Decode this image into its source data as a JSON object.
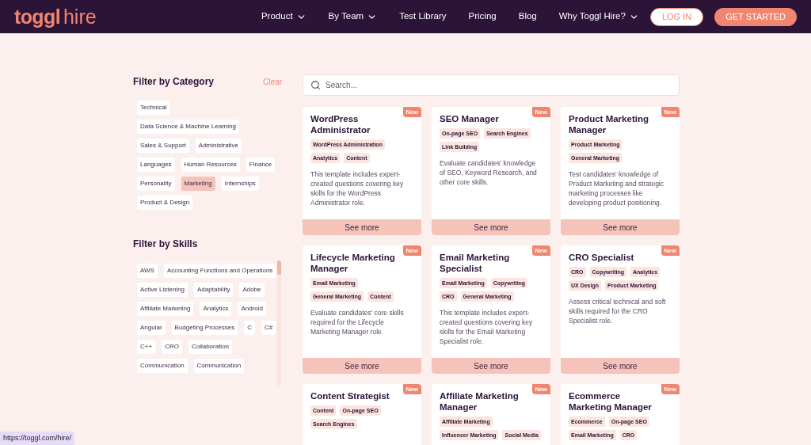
{
  "logo": {
    "brand": "toggl",
    "product": "hire"
  },
  "nav": [
    {
      "label": "Product",
      "has_menu": true
    },
    {
      "label": "By Team",
      "has_menu": true
    },
    {
      "label": "Test Library",
      "has_menu": false
    },
    {
      "label": "Pricing",
      "has_menu": false
    },
    {
      "label": "Blog",
      "has_menu": false
    },
    {
      "label": "Why Toggl Hire?",
      "has_menu": true
    }
  ],
  "nav_buttons": [
    {
      "label": "LOG IN",
      "kind": "outline"
    },
    {
      "label": "GET STARTED",
      "kind": "filled"
    }
  ],
  "category_filter": {
    "title": "Filter by Category",
    "clear": "Clear",
    "chips": [
      {
        "label": "Technical",
        "selected": false
      },
      {
        "label": "Data Science & Machine Learning",
        "selected": false
      },
      {
        "label": "Sales & Support",
        "selected": false
      },
      {
        "label": "Administrative",
        "selected": false
      },
      {
        "label": "Languages",
        "selected": false
      },
      {
        "label": "Human Resources",
        "selected": false
      },
      {
        "label": "Finance",
        "selected": false
      },
      {
        "label": "Personality",
        "selected": false
      },
      {
        "label": "Marketing",
        "selected": true
      },
      {
        "label": "Internships",
        "selected": false
      },
      {
        "label": "Product & Design",
        "selected": false
      }
    ]
  },
  "skills_filter": {
    "title": "Filter by Skills",
    "chips": [
      "AWS",
      "Accounting Functions and Operations",
      "Active Listening",
      "Adaptability",
      "Adobe",
      "Affiliate Marketing",
      "Analytics",
      "Android",
      "Angular",
      "Budgeting Processes",
      "C",
      "C#",
      "C++",
      "CRO",
      "Collaboration",
      "Communication",
      "Communication"
    ]
  },
  "search": {
    "placeholder": "Search..."
  },
  "cards": [
    {
      "title": "WordPress Administrator",
      "badge": "New",
      "tags": [
        "WordPress Administration",
        "Analytics",
        "Content"
      ],
      "description": "This template includes expert-created questions covering key skills for the WordPress Administrator role.",
      "button": "See more"
    },
    {
      "title": "SEO Manager",
      "badge": "New",
      "tags": [
        "On-page SEO",
        "Search Engines",
        "Link Building"
      ],
      "description": "Evaluate candidates' knowledge of SEO, Keyword Research, and other core skills.",
      "button": "See more"
    },
    {
      "title": "Product Marketing Manager",
      "badge": "New",
      "tags": [
        "Product Marketing",
        "General Marketing"
      ],
      "description": "Test candidates' knowledge of Product Marketing and strategic marketing processes like developing product positioning.",
      "button": "See more"
    },
    {
      "title": "Lifecycle Marketing Manager",
      "badge": "New",
      "tags": [
        "Email Marketing",
        "General Marketing",
        "Content"
      ],
      "description": "Evaluate candidates' core skills required for the Lifecycle Marketing Manager role.",
      "button": "See more"
    },
    {
      "title": "Email Marketing Specialist",
      "badge": "New",
      "tags": [
        "Email Marketing",
        "Copywriting",
        "CRO",
        "General Marketing"
      ],
      "description": "This template includes expert-created questions covering key skills for the Email Marketing Specialist role.",
      "button": "See more"
    },
    {
      "title": "CRO Specialist",
      "badge": "New",
      "tags": [
        "CRO",
        "Copywriting",
        "Analytics",
        "UX Design",
        "Product Marketing"
      ],
      "description": "Assess critical technical and soft skills required for the CRO Specialist role.",
      "button": "See more"
    },
    {
      "title": "Content Strategist",
      "badge": "New",
      "tags": [
        "Content",
        "On-page SEO",
        "Search Engines"
      ]
    },
    {
      "title": "Affiliate Marketing Manager",
      "badge": "New",
      "tags": [
        "Affiliate Marketing",
        "Influencer Marketing",
        "Social Media"
      ]
    },
    {
      "title": "Ecommerce Marketing Manager",
      "badge": "New",
      "tags": [
        "Ecommerce",
        "On-page SEO",
        "Email Marketing",
        "CRO"
      ]
    }
  ],
  "status_url": "https://toggl.com/hire/"
}
